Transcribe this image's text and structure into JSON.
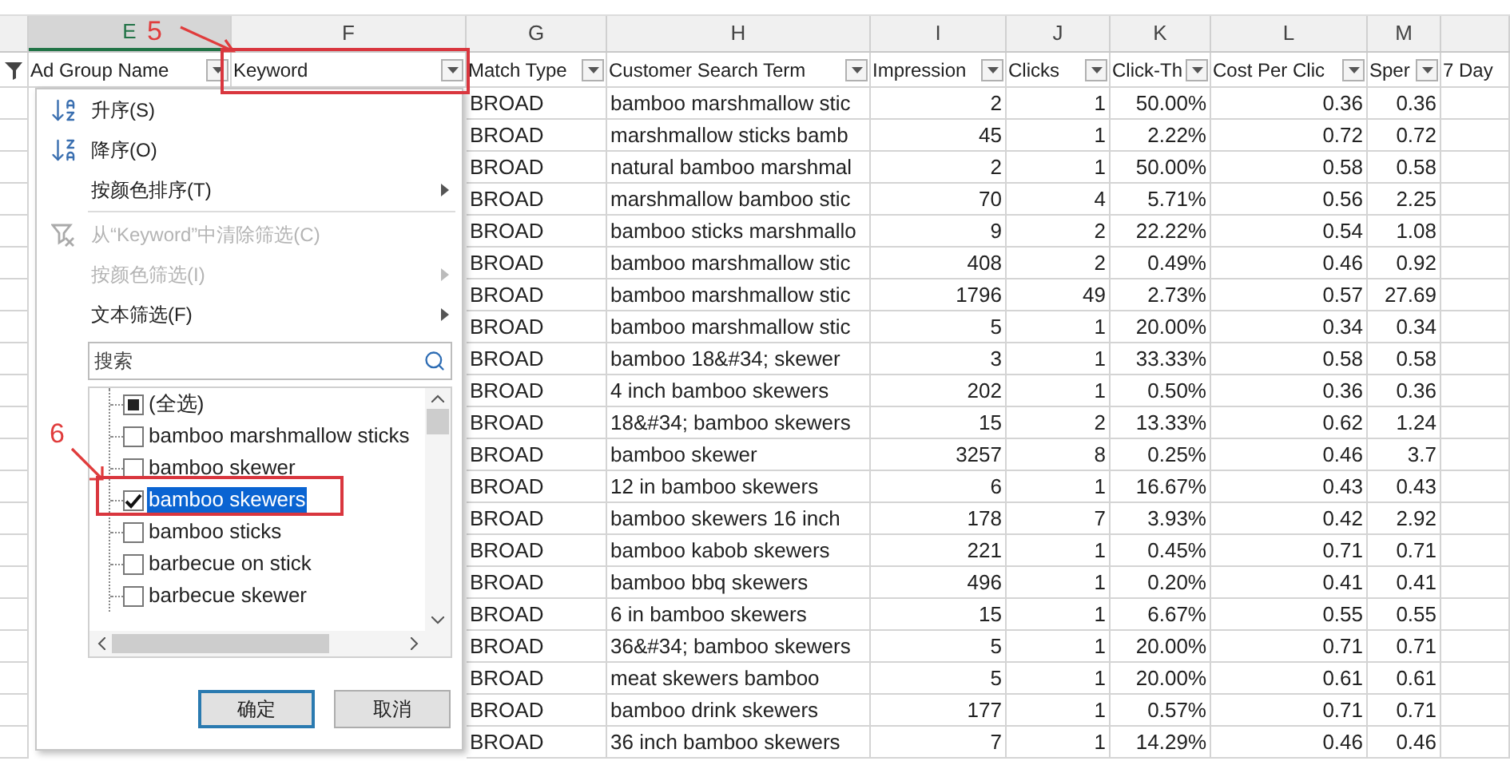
{
  "columns": [
    {
      "letter": "E",
      "title": "Ad Group Name",
      "selected": true
    },
    {
      "letter": "F",
      "title": "Keyword",
      "selected": false
    },
    {
      "letter": "G",
      "title": "Match Type",
      "selected": false,
      "kind": "text"
    },
    {
      "letter": "H",
      "title": "Customer Search Term",
      "selected": false,
      "kind": "text"
    },
    {
      "letter": "I",
      "title": "Impression",
      "selected": false,
      "kind": "number"
    },
    {
      "letter": "J",
      "title": "Clicks",
      "selected": false,
      "kind": "number"
    },
    {
      "letter": "K",
      "title": "Click-Th",
      "selected": false,
      "kind": "number"
    },
    {
      "letter": "L",
      "title": "Cost Per Clic",
      "selected": false,
      "kind": "number"
    },
    {
      "letter": "M",
      "title": "Sper",
      "selected": false,
      "kind": "number"
    },
    {
      "title": "7 Day",
      "selected": false
    }
  ],
  "rows": [
    [
      "BROAD",
      "bamboo marshmallow stic",
      "2",
      "1",
      "50.00%",
      "0.36",
      "0.36"
    ],
    [
      "BROAD",
      "marshmallow sticks bamb",
      "45",
      "1",
      "2.22%",
      "0.72",
      "0.72"
    ],
    [
      "BROAD",
      "natural bamboo marshmal",
      "2",
      "1",
      "50.00%",
      "0.58",
      "0.58"
    ],
    [
      "BROAD",
      "marshmallow bamboo stic",
      "70",
      "4",
      "5.71%",
      "0.56",
      "2.25"
    ],
    [
      "BROAD",
      "bamboo sticks marshmallo",
      "9",
      "2",
      "22.22%",
      "0.54",
      "1.08"
    ],
    [
      "BROAD",
      "bamboo marshmallow stic",
      "408",
      "2",
      "0.49%",
      "0.46",
      "0.92"
    ],
    [
      "BROAD",
      "bamboo marshmallow stic",
      "1796",
      "49",
      "2.73%",
      "0.57",
      "27.69"
    ],
    [
      "BROAD",
      "bamboo marshmallow stic",
      "5",
      "1",
      "20.00%",
      "0.34",
      "0.34"
    ],
    [
      "BROAD",
      "bamboo 18&#34; skewer",
      "3",
      "1",
      "33.33%",
      "0.58",
      "0.58"
    ],
    [
      "BROAD",
      "4 inch bamboo skewers",
      "202",
      "1",
      "0.50%",
      "0.36",
      "0.36"
    ],
    [
      "BROAD",
      "18&#34; bamboo skewers",
      "15",
      "2",
      "13.33%",
      "0.62",
      "1.24"
    ],
    [
      "BROAD",
      "bamboo skewer",
      "3257",
      "8",
      "0.25%",
      "0.46",
      "3.7"
    ],
    [
      "BROAD",
      "12 in bamboo skewers",
      "6",
      "1",
      "16.67%",
      "0.43",
      "0.43"
    ],
    [
      "BROAD",
      "bamboo skewers 16 inch",
      "178",
      "7",
      "3.93%",
      "0.42",
      "2.92"
    ],
    [
      "BROAD",
      "bamboo kabob skewers",
      "221",
      "1",
      "0.45%",
      "0.71",
      "0.71"
    ],
    [
      "BROAD",
      "bamboo bbq skewers",
      "496",
      "1",
      "0.20%",
      "0.41",
      "0.41"
    ],
    [
      "BROAD",
      "6 in bamboo skewers",
      "15",
      "1",
      "6.67%",
      "0.55",
      "0.55"
    ],
    [
      "BROAD",
      "36&#34; bamboo skewers",
      "5",
      "1",
      "20.00%",
      "0.71",
      "0.71"
    ],
    [
      "BROAD",
      "meat skewers bamboo",
      "5",
      "1",
      "20.00%",
      "0.61",
      "0.61"
    ],
    [
      "BROAD",
      "bamboo drink skewers",
      "177",
      "1",
      "0.57%",
      "0.71",
      "0.71"
    ],
    [
      "BROAD",
      "36 inch bamboo skewers",
      "7",
      "1",
      "14.29%",
      "0.46",
      "0.46"
    ]
  ],
  "filter_menu": {
    "items": [
      {
        "kind": "sort-asc",
        "label": "升序(S)",
        "disabled": false,
        "submenu": false
      },
      {
        "kind": "sort-desc",
        "label": "降序(O)",
        "disabled": false,
        "submenu": false
      },
      {
        "kind": "plain",
        "label": "按颜色排序(T)",
        "disabled": false,
        "submenu": true
      },
      {
        "kind": "separator"
      },
      {
        "kind": "clear-filter",
        "label": "从“Keyword”中清除筛选(C)",
        "disabled": true,
        "submenu": false
      },
      {
        "kind": "plain",
        "label": "按颜色筛选(I)",
        "disabled": true,
        "submenu": true
      },
      {
        "kind": "plain",
        "label": "文本筛选(F)",
        "disabled": false,
        "submenu": true
      }
    ],
    "search": {
      "placeholder": "搜索"
    },
    "values": [
      {
        "label": "(全选)",
        "checked": false,
        "indeterminate": true,
        "selected": false
      },
      {
        "label": "bamboo marshmallow sticks",
        "checked": false,
        "indeterminate": false,
        "selected": false
      },
      {
        "label": "bamboo skewer",
        "checked": false,
        "indeterminate": false,
        "selected": false
      },
      {
        "label": "bamboo skewers",
        "checked": true,
        "indeterminate": false,
        "selected": true
      },
      {
        "label": "bamboo sticks",
        "checked": false,
        "indeterminate": false,
        "selected": false
      },
      {
        "label": "barbecue on stick",
        "checked": false,
        "indeterminate": false,
        "selected": false
      },
      {
        "label": "barbecue skewer",
        "checked": false,
        "indeterminate": false,
        "selected": false
      }
    ],
    "buttons": [
      {
        "label": "确定",
        "focused": true
      },
      {
        "label": "取消",
        "focused": false
      }
    ]
  },
  "annotations": [
    {
      "label": "5"
    },
    {
      "label": "6"
    }
  ]
}
